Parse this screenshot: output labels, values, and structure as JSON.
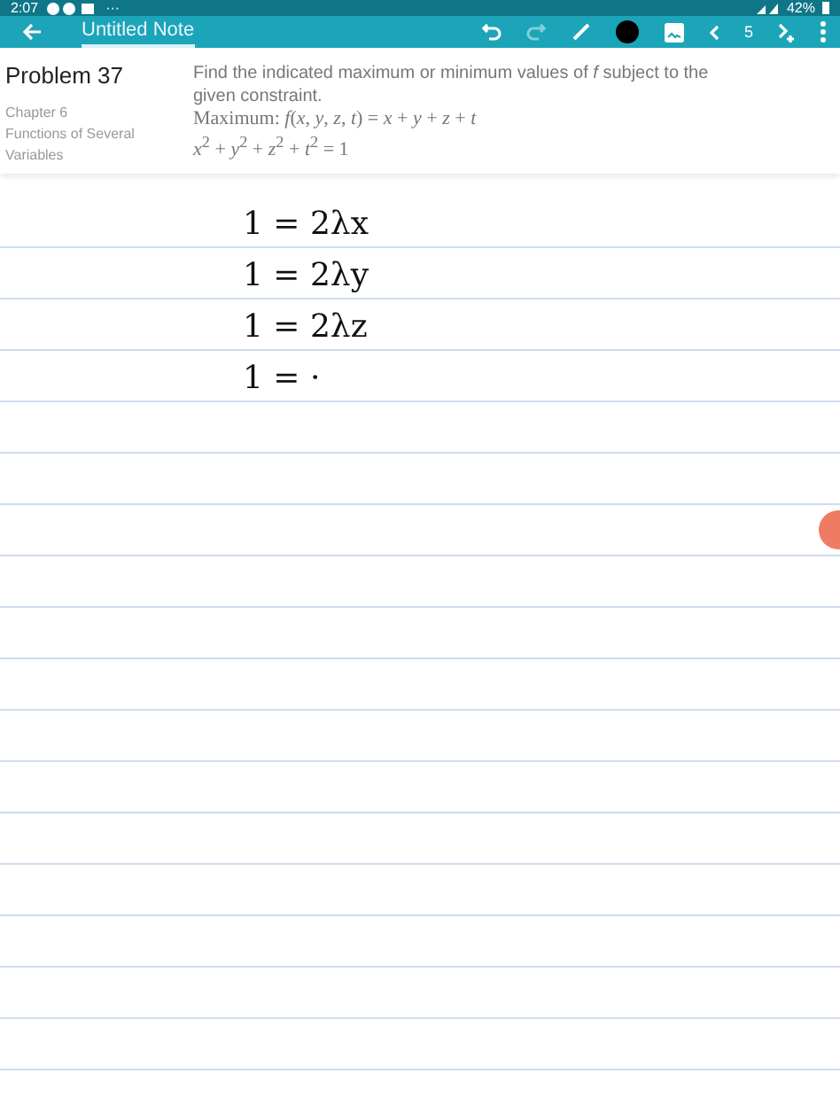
{
  "status_bar": {
    "time": "2:07",
    "dots": "···",
    "battery": "42%"
  },
  "toolbar": {
    "title": "Untitled Note",
    "page": "5",
    "redo_disabled": true
  },
  "problem": {
    "title": "Problem 37",
    "chapter": "Chapter 6",
    "section": "Functions of Several Variables",
    "text": "Find the indicated maximum or minimum values of *f* subject to the given constraint.",
    "objective": "Maximum: *f*(*x*, *y*, *z*, *t*) = *x* + *y* + *z* + *t*",
    "constraint": "*x*$^{2}$ + *y*$^{2}$ + *z*$^{2}$ + *t*$^{2}$ = 1"
  },
  "ink_lines": [
    "1 = 2λx",
    "1 = 2λy",
    "1 = 2λz",
    "1 = ·"
  ]
}
